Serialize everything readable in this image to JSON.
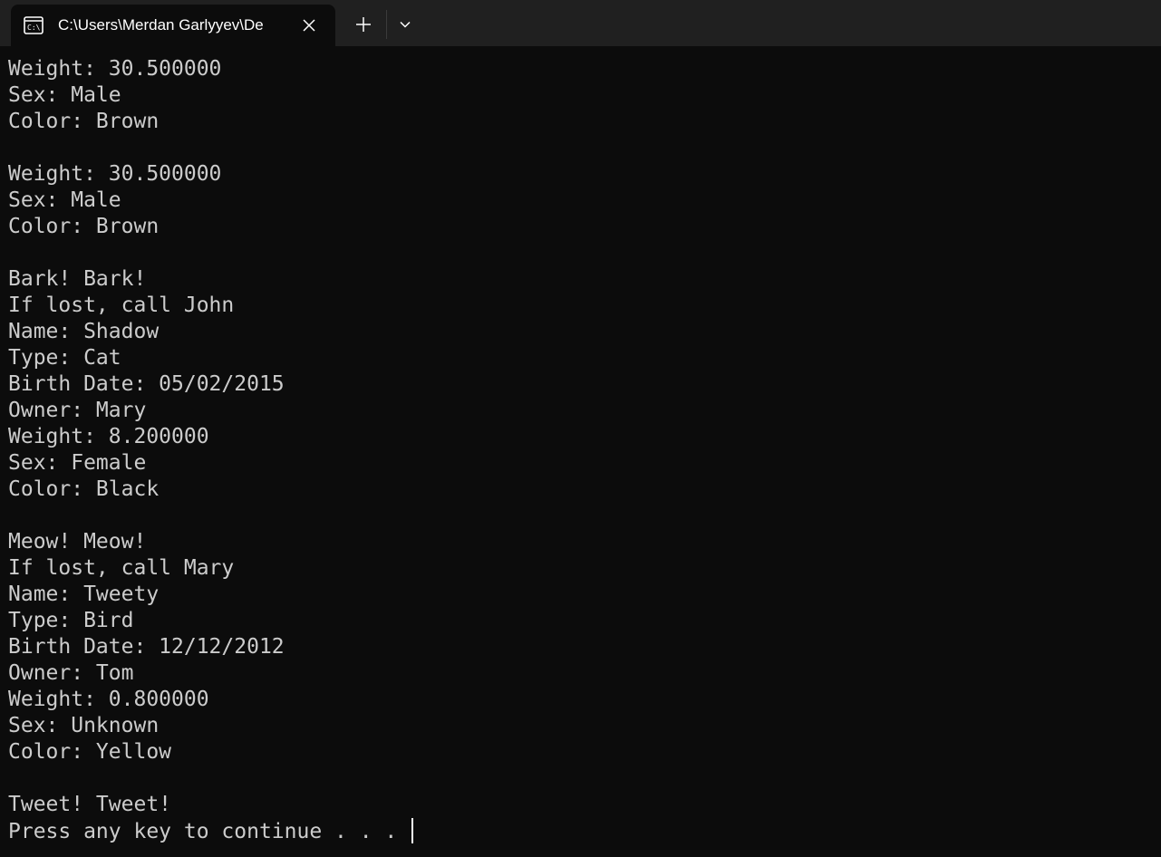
{
  "tab": {
    "title": "C:\\Users\\Merdan Garlyyev\\De",
    "icon": "console-icon",
    "close_icon": "close-icon"
  },
  "toolbar": {
    "new_tab_icon": "plus-icon",
    "dropdown_icon": "chevron-down-icon"
  },
  "colors": {
    "background": "#0c0c0c",
    "tabbar": "#202020",
    "text": "#cccccc"
  },
  "terminal": {
    "lines": [
      "Weight: 30.500000",
      "Sex: Male",
      "Color: Brown",
      "",
      "Weight: 30.500000",
      "Sex: Male",
      "Color: Brown",
      "",
      "Bark! Bark!",
      "If lost, call John",
      "Name: Shadow",
      "Type: Cat",
      "Birth Date: 05/02/2015",
      "Owner: Mary",
      "Weight: 8.200000",
      "Sex: Female",
      "Color: Black",
      "",
      "Meow! Meow!",
      "If lost, call Mary",
      "Name: Tweety",
      "Type: Bird",
      "Birth Date: 12/12/2012",
      "Owner: Tom",
      "Weight: 0.800000",
      "Sex: Unknown",
      "Color: Yellow",
      "",
      "Tweet! Tweet!",
      "Press any key to continue . . . "
    ]
  }
}
